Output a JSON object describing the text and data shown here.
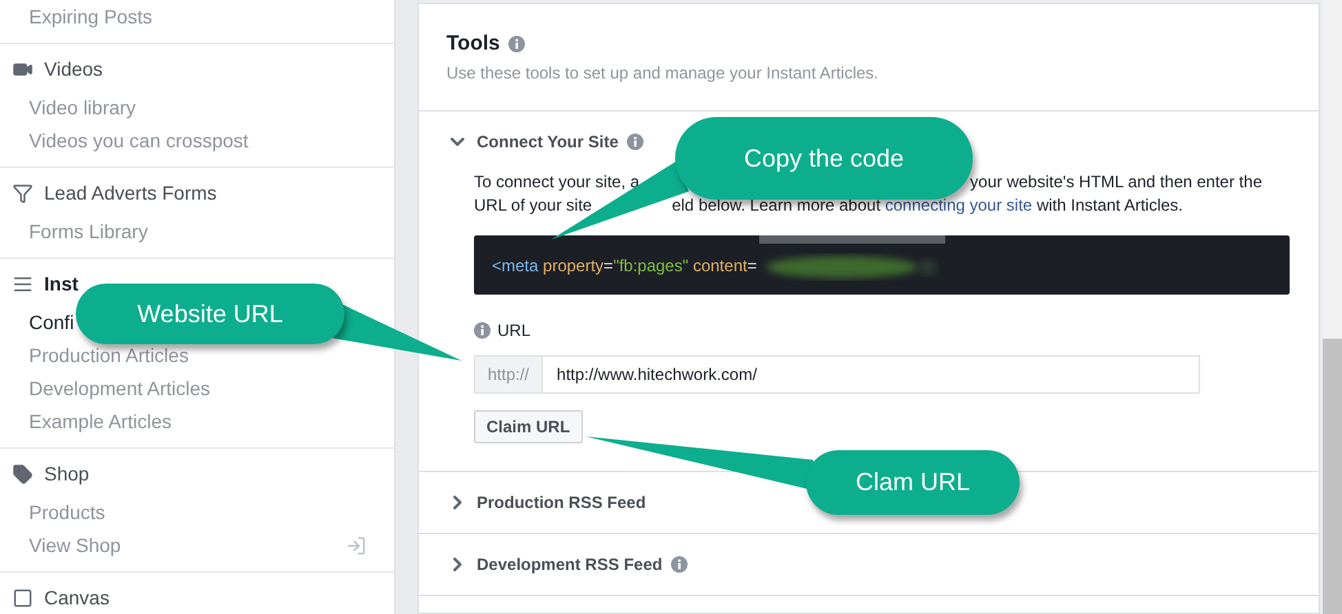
{
  "sidebar": {
    "sections": [
      {
        "items": [
          {
            "label": "Expiring Posts",
            "selected": false
          }
        ]
      },
      {
        "title": "Videos",
        "active": false,
        "items": [
          {
            "label": "Video library",
            "selected": false
          },
          {
            "label": "Videos you can crosspost",
            "selected": false
          }
        ]
      },
      {
        "title": "Lead Adverts Forms",
        "active": false,
        "items": [
          {
            "label": "Forms Library",
            "selected": false
          }
        ]
      },
      {
        "title": "Inst",
        "active": true,
        "items": [
          {
            "label": "Confi",
            "selected": true
          },
          {
            "label": "Production Articles",
            "selected": false
          },
          {
            "label": "Development Articles",
            "selected": false
          },
          {
            "label": "Example Articles",
            "selected": false
          }
        ]
      },
      {
        "title": "Shop",
        "active": false,
        "items": [
          {
            "label": "Products",
            "selected": false
          },
          {
            "label": "View Shop",
            "selected": false,
            "external": true
          }
        ]
      },
      {
        "title": "Canvas",
        "active": false
      }
    ]
  },
  "tools": {
    "title": "Tools",
    "subtitle": "Use these tools to set up and manage your Instant Articles."
  },
  "sections": [
    {
      "title": "Connect Your Site",
      "expanded": true,
      "info": true
    },
    {
      "title": "Production RSS Feed",
      "expanded": false,
      "info": false
    },
    {
      "title": "Development RSS Feed",
      "expanded": false,
      "info": true
    }
  ],
  "connect": {
    "lines": [
      {
        "segments": [
          {
            "kind": "text",
            "text": "To connect your site, a"
          },
          {
            "kind": "text",
            "text": "your website's HTML and then enter the"
          }
        ]
      },
      {
        "segments": [
          {
            "kind": "text",
            "text": "URL of your site"
          },
          {
            "kind": "text",
            "text": "eld below. Learn more about "
          },
          {
            "kind": "link",
            "text": "connecting your site"
          },
          {
            "kind": "text",
            "text": " with Instant Articles."
          }
        ]
      }
    ],
    "code": [
      {
        "kind": "tag",
        "text": "<meta"
      },
      {
        "kind": "attr",
        "text": " property"
      },
      {
        "kind": "punct",
        "text": "="
      },
      {
        "kind": "string",
        "text": "\"fb:pages\""
      },
      {
        "kind": "attr",
        "text": " content"
      },
      {
        "kind": "punct",
        "text": "="
      }
    ],
    "url_label": "URL",
    "url_prefix": "http://",
    "url_value": "http://www.hitechwork.com/",
    "claim_button": "Claim URL"
  },
  "callouts": [
    {
      "text": "Copy the code"
    },
    {
      "text": "Website URL"
    },
    {
      "text": "Clam URL"
    }
  ]
}
